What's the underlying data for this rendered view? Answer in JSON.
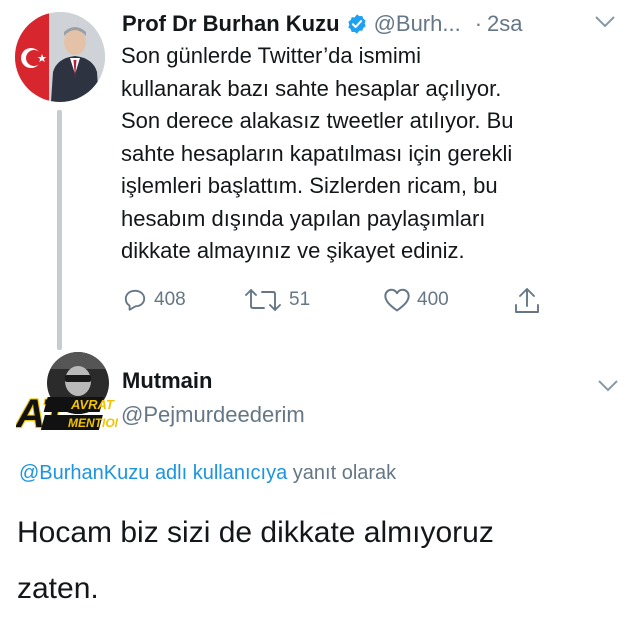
{
  "tweet": {
    "author_name": "Prof Dr Burhan Kuzu",
    "author_handle": "@Burh...",
    "time": "2sa",
    "text_lines": [
      "Son günlerde Twitter’da ismimi",
      "kullanarak bazı sahte hesaplar açılıyor.",
      "Son derece alakasız tweetler atılıyor. Bu",
      "sahte hesapların kapatılması için gerekli",
      "işlemleri başlattım. Sizlerden ricam, bu",
      "hesabım dışında yapılan paylaşımları",
      "dikkate almayınız ve şikayet ediniz."
    ],
    "reply_count": "408",
    "retweet_count": "51",
    "like_count": "400",
    "icons": [
      "verified-badge-icon",
      "chevron-down-icon",
      "reply-icon",
      "retweet-icon",
      "heart-icon",
      "share-icon"
    ]
  },
  "reply": {
    "author_name": "Mutmain",
    "author_handle": "@Pejmurdeederim",
    "avatar_text": {
      "big": "AT",
      "top": "AVRAT",
      "bottom": "MENTION"
    },
    "replying_link": "@BurhanKuzu adlı kullanıcıya",
    "replying_suffix": " yanıt olarak",
    "body_lines": [
      "Hocam biz sizi de dikkate almıyoruz",
      "zaten."
    ]
  },
  "colors": {
    "link": "#1b95e0",
    "verified": "#1da1f2",
    "secondary_text": "#657786",
    "thread_line": "#c7ccd1"
  }
}
